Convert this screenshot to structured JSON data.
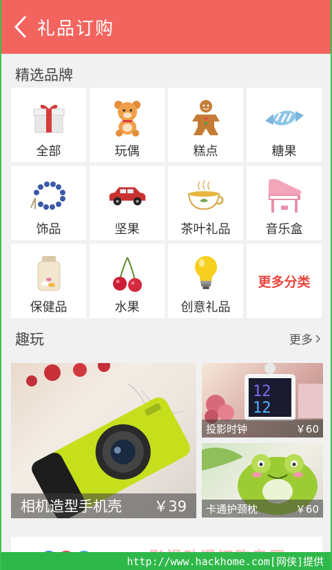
{
  "header": {
    "title": "礼品订购"
  },
  "brands": {
    "title": "精选品牌",
    "items": [
      {
        "label": "全部",
        "icon": "gift-box-icon"
      },
      {
        "label": "玩偶",
        "icon": "teddy-bear-icon"
      },
      {
        "label": "糕点",
        "icon": "gingerbread-icon"
      },
      {
        "label": "糖果",
        "icon": "candy-icon"
      },
      {
        "label": "饰品",
        "icon": "bracelet-icon"
      },
      {
        "label": "坚果",
        "icon": "car-icon"
      },
      {
        "label": "茶叶礼品",
        "icon": "tea-cup-icon"
      },
      {
        "label": "音乐盒",
        "icon": "piano-icon"
      },
      {
        "label": "保健品",
        "icon": "pill-jar-icon"
      },
      {
        "label": "水果",
        "icon": "cherry-icon"
      },
      {
        "label": "创意礼品",
        "icon": "lightbulb-icon"
      }
    ],
    "more_label": "更多分类"
  },
  "fun": {
    "title": "趣玩",
    "more_label": "更多",
    "featured": {
      "name": "相机造型手机壳",
      "price": "￥39"
    },
    "items": [
      {
        "name": "投影时钟",
        "price": "￥60"
      },
      {
        "name": "卡通护颈枕",
        "price": "￥60"
      }
    ]
  },
  "banner": {
    "text": "影视动漫订购专区"
  },
  "watermark": "http://www.hackhome.com[网侠]提供",
  "colors": {
    "accent": "#f4645e",
    "more": "#e9473f"
  }
}
